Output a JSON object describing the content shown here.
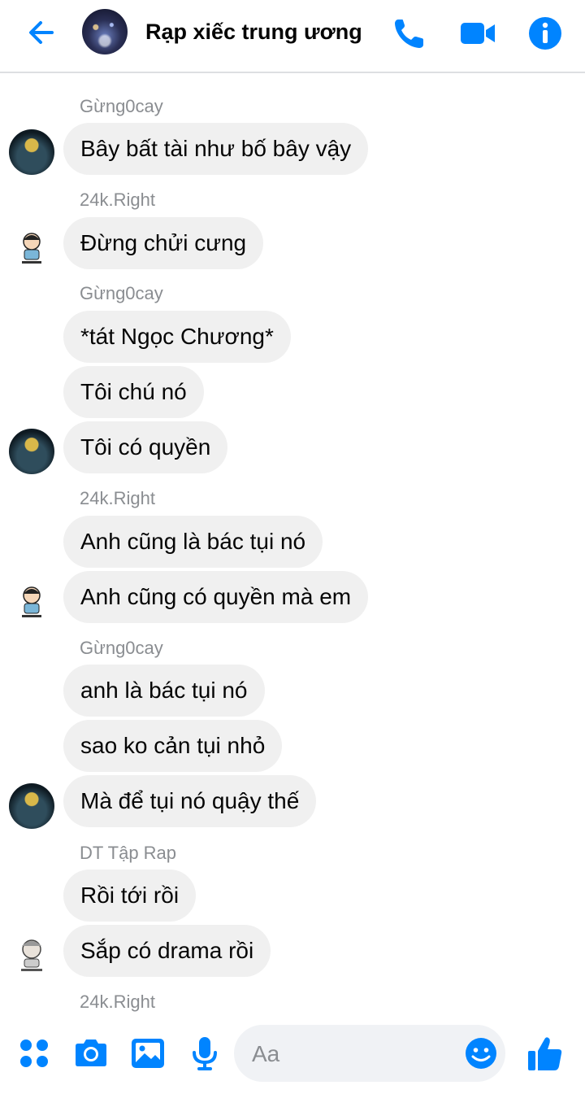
{
  "header": {
    "back_icon": "arrow-left-icon",
    "title": "Rạp xiếc trung ương",
    "call_icon": "phone-icon",
    "video_icon": "video-camera-icon",
    "info_icon": "info-icon"
  },
  "messages": [
    {
      "sender": "Gừng0cay",
      "texts": [
        "Bây bất tài như bố bây vậy"
      ]
    },
    {
      "sender": "24k.Right",
      "texts": [
        "Đừng chửi cưng"
      ]
    },
    {
      "sender": "Gừng0cay",
      "texts": [
        "*tát Ngọc Chương*",
        "Tôi chú nó",
        "Tôi có quyền"
      ]
    },
    {
      "sender": "24k.Right",
      "texts": [
        "Anh cũng là bác tụi nó",
        "Anh cũng có quyền mà em"
      ]
    },
    {
      "sender": "Gừng0cay",
      "texts": [
        "anh là bác tụi nó",
        "sao ko cản tụi nhỏ",
        "Mà để tụi nó quậy thế"
      ]
    },
    {
      "sender": "DT Tập Rap",
      "texts": [
        "Rồi tới rồi",
        "Sắp có drama rồi"
      ]
    },
    {
      "sender": "24k.Right",
      "texts": []
    }
  ],
  "composer": {
    "placeholder": "Aa",
    "value": "",
    "apps_icon": "apps-grid-icon",
    "camera_icon": "camera-icon",
    "gallery_icon": "gallery-icon",
    "mic_icon": "microphone-icon",
    "emoji_icon": "emoji-icon",
    "like_icon": "thumbs-up-icon"
  },
  "colors": {
    "accent": "#0084ff",
    "bubble": "#f0f0f0",
    "sender_text": "#8a8d91"
  }
}
